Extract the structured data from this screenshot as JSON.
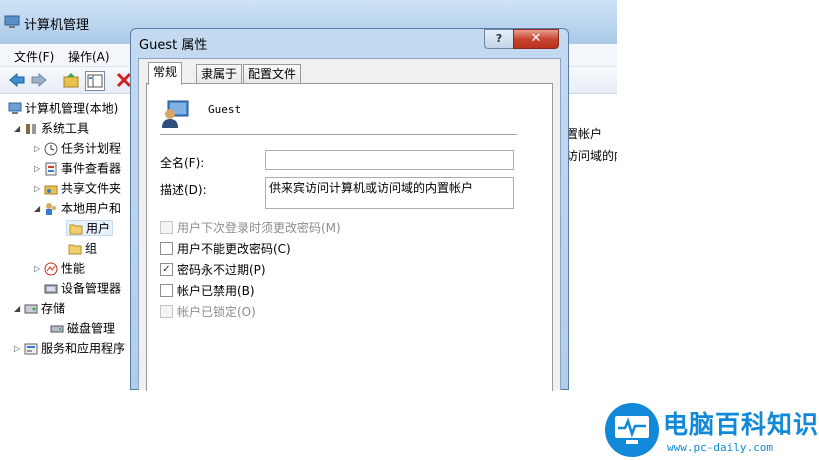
{
  "main_window": {
    "title": "计算机管理",
    "menu": [
      "文件(F)",
      "操作(A)"
    ],
    "tree": [
      {
        "label": "计算机管理(本地)"
      },
      {
        "label": "系统工具"
      },
      {
        "label": "任务计划程"
      },
      {
        "label": "事件查看器"
      },
      {
        "label": "共享文件夹"
      },
      {
        "label": "本地用户和"
      },
      {
        "label": "用户"
      },
      {
        "label": "组"
      },
      {
        "label": "性能"
      },
      {
        "label": "设备管理器"
      },
      {
        "label": "存储"
      },
      {
        "label": "磁盘管理"
      },
      {
        "label": "服务和应用程序"
      }
    ],
    "right_pane": [
      "置帐户",
      "访问域的内"
    ]
  },
  "dialog": {
    "title": "Guest 属性",
    "help_label": "?",
    "close_label": "✕",
    "tabs": [
      "常规",
      "隶属于",
      "配置文件"
    ],
    "user_name": "Guest",
    "fullname_label": "全名(F):",
    "fullname_value": "",
    "description_label": "描述(D):",
    "description_value": "供来宾访问计算机或访问域的内置帐户",
    "checkboxes": [
      {
        "label": "用户下次登录时须更改密码(M)",
        "checked": false,
        "enabled": false
      },
      {
        "label": "用户不能更改密码(C)",
        "checked": false,
        "enabled": true
      },
      {
        "label": "密码永不过期(P)",
        "checked": true,
        "enabled": true
      },
      {
        "label": "帐户已禁用(B)",
        "checked": false,
        "enabled": true
      },
      {
        "label": "帐户已锁定(O)",
        "checked": false,
        "enabled": false
      }
    ]
  },
  "watermark": {
    "name": "电脑百科知识",
    "url": "www.pc-daily.com"
  },
  "colors": {
    "accent": "#1189d8",
    "close": "#c74630"
  }
}
